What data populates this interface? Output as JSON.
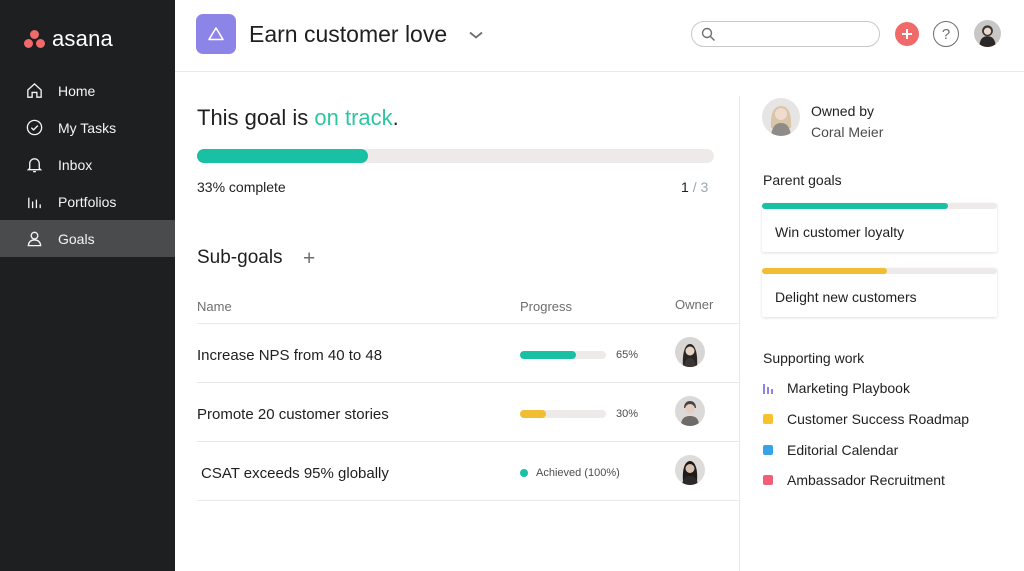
{
  "brand": {
    "name": "asana"
  },
  "nav": {
    "items": [
      {
        "label": "Home",
        "icon": "home-icon"
      },
      {
        "label": "My Tasks",
        "icon": "check-circle-icon"
      },
      {
        "label": "Inbox",
        "icon": "bell-icon"
      },
      {
        "label": "Portfolios",
        "icon": "bar-chart-icon"
      },
      {
        "label": "Goals",
        "icon": "person-icon",
        "active": true
      }
    ]
  },
  "header": {
    "title": "Earn customer love",
    "search_placeholder": "",
    "help_label": "?"
  },
  "goal": {
    "status_prefix": "This goal is ",
    "status_value": "on track",
    "status_suffix": ".",
    "progress": 0.33,
    "percent_text": "33% complete",
    "completed": "1",
    "total": "/ 3"
  },
  "subgoals": {
    "title": "Sub-goals",
    "add_label": "+",
    "columns": {
      "name": "Name",
      "progress": "Progress",
      "owner": "Owner"
    },
    "rows": [
      {
        "name": "Increase NPS from 40 to 48",
        "progress": 0.65,
        "pct": "65%",
        "color": "#1ac0a3"
      },
      {
        "name": "Promote 20 customer stories",
        "progress": 0.3,
        "pct": "30%",
        "color": "#f1bd33"
      },
      {
        "name": "CSAT exceeds 95% globally",
        "achieved": "Achieved (100%)"
      }
    ]
  },
  "owner": {
    "label": "Owned by",
    "name": "Coral Meier"
  },
  "parent_goals": {
    "title": "Parent goals",
    "items": [
      {
        "label": "Win customer loyalty",
        "progress": 0.79,
        "color": "#1ac0a3"
      },
      {
        "label": "Delight new customers",
        "progress": 0.53,
        "color": "#f1bd33"
      }
    ]
  },
  "supporting_work": {
    "title": "Supporting work",
    "items": [
      {
        "label": "Marketing Playbook",
        "icon": "portfolio-icon",
        "color": "#8d84e8"
      },
      {
        "label": "Customer Success Roadmap",
        "icon": "project-square",
        "color": "#f8c22e"
      },
      {
        "label": "Editorial Calendar",
        "icon": "project-square",
        "color": "#37a3e6"
      },
      {
        "label": "Ambassador Recruitment",
        "icon": "project-square",
        "color": "#f0607a"
      }
    ]
  },
  "colors": {
    "sidebar": "#1e1f21",
    "accent_green": "#1ac0a3",
    "accent_yellow": "#f1bd33",
    "brand_coral": "#f06a6a",
    "goal_purple": "#8d84e8"
  }
}
